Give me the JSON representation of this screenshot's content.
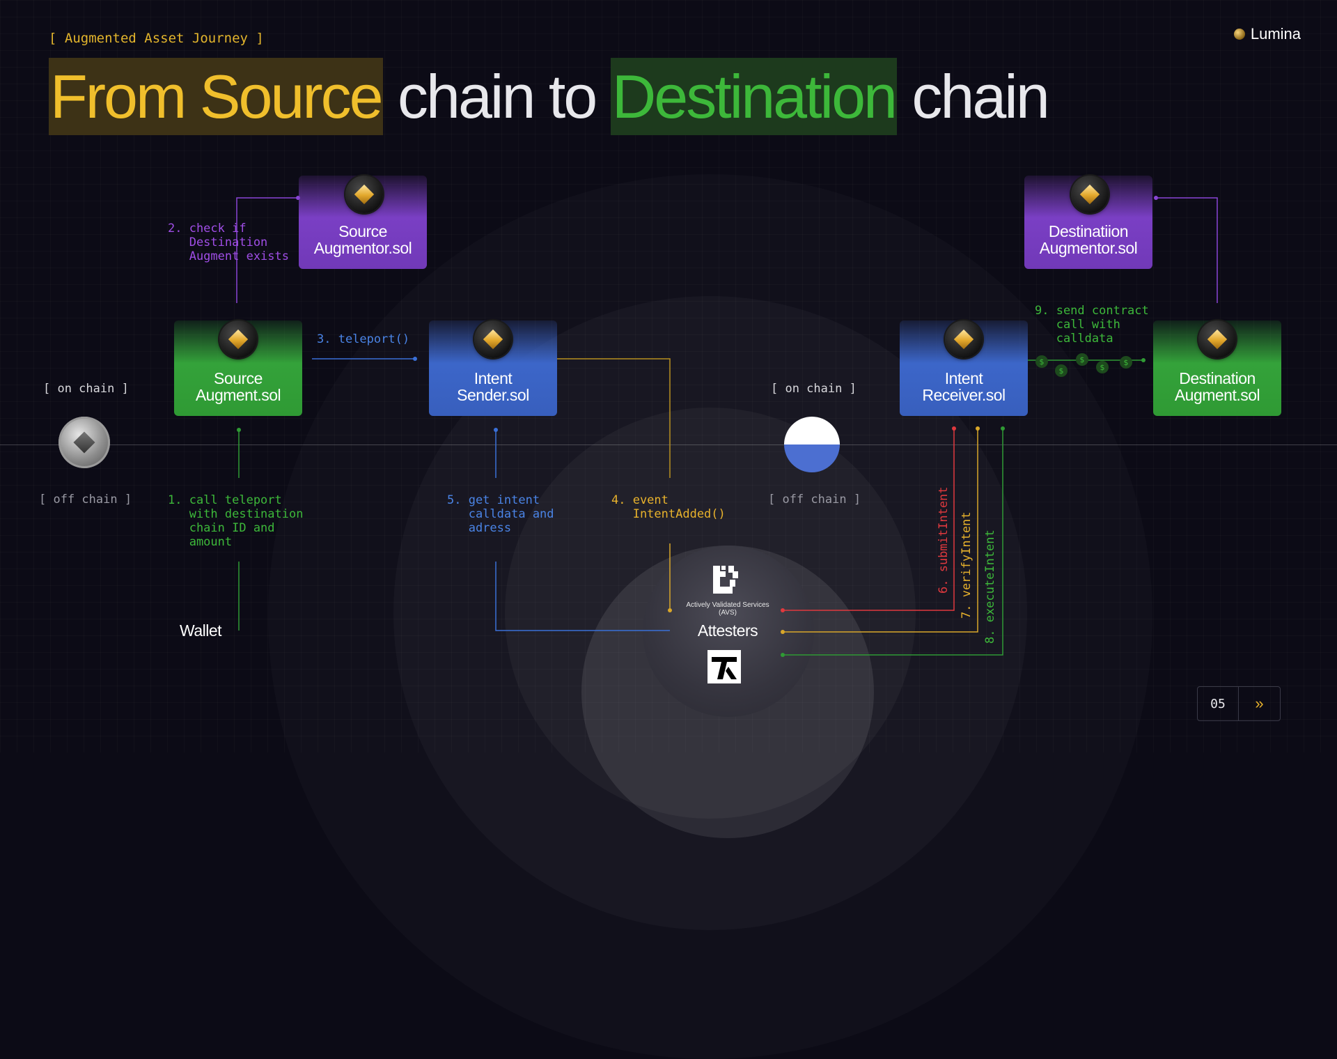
{
  "header": {
    "tag": "[ Augmented Asset Journey ]",
    "brand": "Lumina"
  },
  "title": {
    "part1": "From Source",
    "part2": "chain to",
    "part3": "Destination",
    "part4": "chain"
  },
  "zones": {
    "left_on": "[ on chain ]",
    "left_off": "[ off chain ]",
    "mid_on": "[ on chain ]",
    "mid_off": "[ off chain ]"
  },
  "boxes": {
    "source_augmentor": [
      "Source",
      "Augmentor.sol"
    ],
    "source_augment": [
      "Source",
      "Augment.sol"
    ],
    "intent_sender": [
      "Intent",
      "Sender.sol"
    ],
    "intent_receiver": [
      "Intent",
      "Receiver.sol"
    ],
    "destination_augmentor": [
      "Destinatiion",
      "Augmentor.sol"
    ],
    "destination_augment": [
      "Destination",
      "Augment.sol"
    ]
  },
  "steps": {
    "s1": "1. call teleport\n   with destination\n   chain ID and\n   amount",
    "s2": "2. check if\n   Destination\n   Augment exists",
    "s3": "3. teleport()",
    "s4": "4. event\n   IntentAdded()",
    "s5": "5. get intent\n   calldata and\n   adress",
    "s6": "6. submitIntent",
    "s7": "7. verifyIntent",
    "s8": "8. executeIntent",
    "s9": "9. send contract\n   call with\n   calldata"
  },
  "actors": {
    "wallet": "Wallet",
    "avs": "Actively Validated Services (AVS)",
    "attesters": "Attesters"
  },
  "pager": {
    "page": "05",
    "next_icon": "double-chevron-right-icon"
  },
  "colors": {
    "yellow": "#f0bf2c",
    "green": "#3db83a",
    "blue": "#4a84e6",
    "purple": "#a04ee6",
    "red": "#e0393e"
  }
}
